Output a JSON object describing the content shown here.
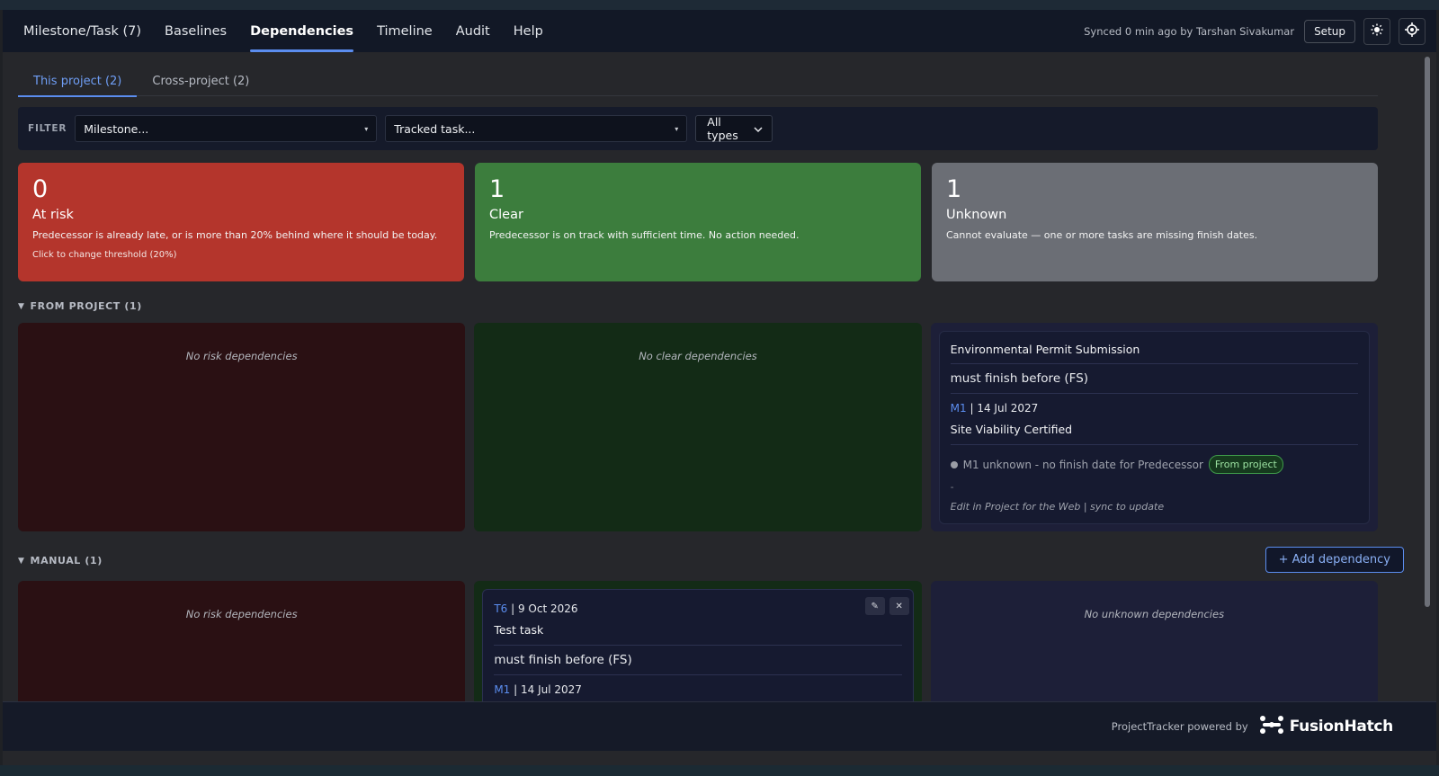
{
  "nav": {
    "tabs": [
      {
        "label": "Milestone/Task (7)"
      },
      {
        "label": "Baselines"
      },
      {
        "label": "Dependencies"
      },
      {
        "label": "Timeline"
      },
      {
        "label": "Audit"
      },
      {
        "label": "Help"
      }
    ],
    "active_tab": "Dependencies",
    "sync_text": "Synced 0 min ago by Tarshan Sivakumar",
    "setup_label": "Setup",
    "theme_icon": "sun-icon",
    "locate_icon": "target-icon"
  },
  "subtabs": [
    {
      "label": "This project (2)",
      "active": true
    },
    {
      "label": "Cross-project (2)",
      "active": false
    }
  ],
  "filter": {
    "label": "FILTER",
    "milestone_value": "Milestone...",
    "task_value": "Tracked task...",
    "type_value": "All types"
  },
  "summary": {
    "risk": {
      "count": "0",
      "title": "At risk",
      "desc": "Predecessor is already late, or is more than 20% behind where it should be today.",
      "note": "Click to change threshold (20%)"
    },
    "clear": {
      "count": "1",
      "title": "Clear",
      "desc": "Predecessor is on track with sufficient time. No action needed."
    },
    "unknown": {
      "count": "1",
      "title": "Unknown",
      "desc": "Cannot evaluate — one or more tasks are missing finish dates."
    }
  },
  "sections": {
    "from_project": {
      "title": "FROM PROJECT (1)",
      "risk_empty": "No risk dependencies",
      "clear_empty": "No clear dependencies",
      "unknown_item": {
        "predecessor": "Environmental Permit Submission",
        "relation": "must finish before (FS)",
        "successor_code": "M1",
        "successor_sep": "| 14 Jul 2027",
        "successor_name": "Site Viability Certified",
        "status": "M1 unknown - no finish date for Predecessor",
        "badge": "From project",
        "dash": "-",
        "edit_note": "Edit in Project for the Web | sync to update"
      }
    },
    "manual": {
      "title": "MANUAL (1)",
      "add_label": "+ Add dependency",
      "risk_empty": "No risk dependencies",
      "unknown_empty": "No unknown dependencies",
      "clear_item": {
        "pred_code": "T6",
        "pred_sep": "| 9 Oct 2026",
        "pred_name": "Test task",
        "relation": "must finish before (FS)",
        "succ_code": "M1",
        "succ_sep": "| 14 Jul 2027",
        "edit_icon": "pencil-icon",
        "delete_icon": "close-icon"
      }
    }
  },
  "footer": {
    "powered": "ProjectTracker powered by",
    "brand": "FusionHatch"
  },
  "colors": {
    "accent": "#5b8def",
    "risk": "#b4352c",
    "clear": "#3c7d3d",
    "unknown": "#6b6e75"
  }
}
